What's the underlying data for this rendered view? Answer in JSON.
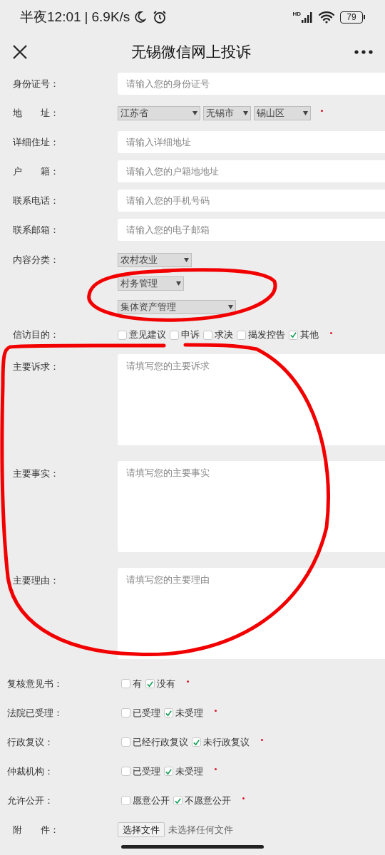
{
  "status_bar": {
    "time": "半夜12:01",
    "separator": "|",
    "speed": "6.9K/s",
    "network_label": "HD",
    "battery": "79"
  },
  "header": {
    "title": "无锡微信网上投诉"
  },
  "form": {
    "rows": [
      {
        "kind": "text",
        "label": "身份证号：",
        "placeholder": "请输入您的身份证号"
      },
      {
        "kind": "selects",
        "label": "地　　址：",
        "selects": [
          "江苏省",
          "无锡市",
          "锡山区"
        ],
        "required": true
      },
      {
        "kind": "text",
        "label": "详细住址：",
        "placeholder": "请输入详细地址"
      },
      {
        "kind": "text",
        "label": "户　　籍：",
        "placeholder": "请输入您的户籍地地址"
      },
      {
        "kind": "text",
        "label": "联系电话：",
        "placeholder": "请输入您的手机号码"
      },
      {
        "kind": "text",
        "label": "联系邮箱：",
        "placeholder": "请输入您的电子邮箱"
      },
      {
        "kind": "stacked_selects",
        "label": "内容分类：",
        "selects": [
          "农村农业",
          "村务管理",
          "集体资产管理"
        ]
      },
      {
        "kind": "checkboxes",
        "label": "信访目的：",
        "options": [
          {
            "label": "意见建议",
            "checked": false
          },
          {
            "label": "申诉",
            "checked": false
          },
          {
            "label": "求决",
            "checked": false
          },
          {
            "label": "揭发控告",
            "checked": false
          },
          {
            "label": "其他",
            "checked": true
          }
        ],
        "required": true
      },
      {
        "kind": "textarea",
        "label": "主要诉求：",
        "placeholder": "请填写您的主要诉求"
      },
      {
        "kind": "textarea",
        "label": "主要事实：",
        "placeholder": "请填写您的主要事实"
      },
      {
        "kind": "textarea",
        "label": "主要理由：",
        "placeholder": "请填写您的主要理由"
      },
      {
        "kind": "checkboxes",
        "label": "复核意见书：",
        "options": [
          {
            "label": "有",
            "checked": false
          },
          {
            "label": "没有",
            "checked": true
          }
        ],
        "required": true
      },
      {
        "kind": "checkboxes",
        "label": "法院已受理：",
        "options": [
          {
            "label": "已受理",
            "checked": false
          },
          {
            "label": "未受理",
            "checked": true
          }
        ],
        "required": true
      },
      {
        "kind": "checkboxes",
        "label": "行政复议：",
        "options": [
          {
            "label": "已经行政复议",
            "checked": false
          },
          {
            "label": "未行政复议",
            "checked": true
          }
        ],
        "required": true
      },
      {
        "kind": "checkboxes",
        "label": "仲裁机构：",
        "options": [
          {
            "label": "已受理",
            "checked": false
          },
          {
            "label": "未受理",
            "checked": true
          }
        ],
        "required": true
      },
      {
        "kind": "checkboxes",
        "label": "允许公开：",
        "options": [
          {
            "label": "愿意公开",
            "checked": false
          },
          {
            "label": "不愿意公开",
            "checked": true
          }
        ],
        "required": true
      },
      {
        "kind": "file",
        "label": "附　　件：",
        "button": "选择文件",
        "status": "未选择任何文件"
      }
    ]
  }
}
